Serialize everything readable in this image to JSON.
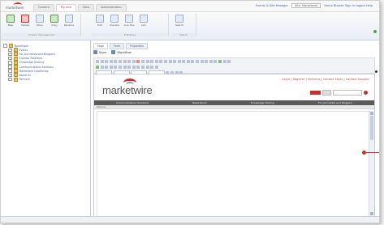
{
  "brand": {
    "name": "marketwire",
    "sub": "Tracking"
  },
  "app_tabs": [
    "Content",
    "My Info",
    "View",
    "Administration"
  ],
  "top_links": [
    "Events & Site Manager",
    "Site: Marketwire",
    "Home  Browse  Sign-in  Logout  Help"
  ],
  "ribbon": {
    "groups": [
      {
        "label": "Content Management",
        "buttons": [
          "New",
          "Delete",
          "Move",
          "Copy",
          "Rename"
        ]
      },
      {
        "label": "Edit/Save",
        "buttons": [
          "Edit",
          "Preview",
          "Live Site",
          "Link"
        ]
      },
      {
        "label": "Search",
        "buttons": [
          "Search"
        ]
      }
    ]
  },
  "tree": {
    "root": "Marketwire",
    "items": [
      "Events",
      "For Journalists and Bloggers",
      "Investor Relations",
      "Knowledge Sharing",
      "Communications Solutions",
      "Marketwire Leadership",
      "About Us",
      "Partners"
    ]
  },
  "doc_tabs": [
    "Page",
    "Form",
    "Properties"
  ],
  "actions": {
    "save": "Save",
    "workflow": "Workflow"
  },
  "page_preview": {
    "top_links": "Login  |  Register  |  Partners  |  Contact Sales  |  Contact Support",
    "logo_word": "marketwire",
    "search_placeholder": "Search",
    "nav": [
      "Communications Solutions",
      "News Room",
      "Knowledge Sharing",
      "For Journalists and Bloggers"
    ],
    "subnav": "Options"
  }
}
